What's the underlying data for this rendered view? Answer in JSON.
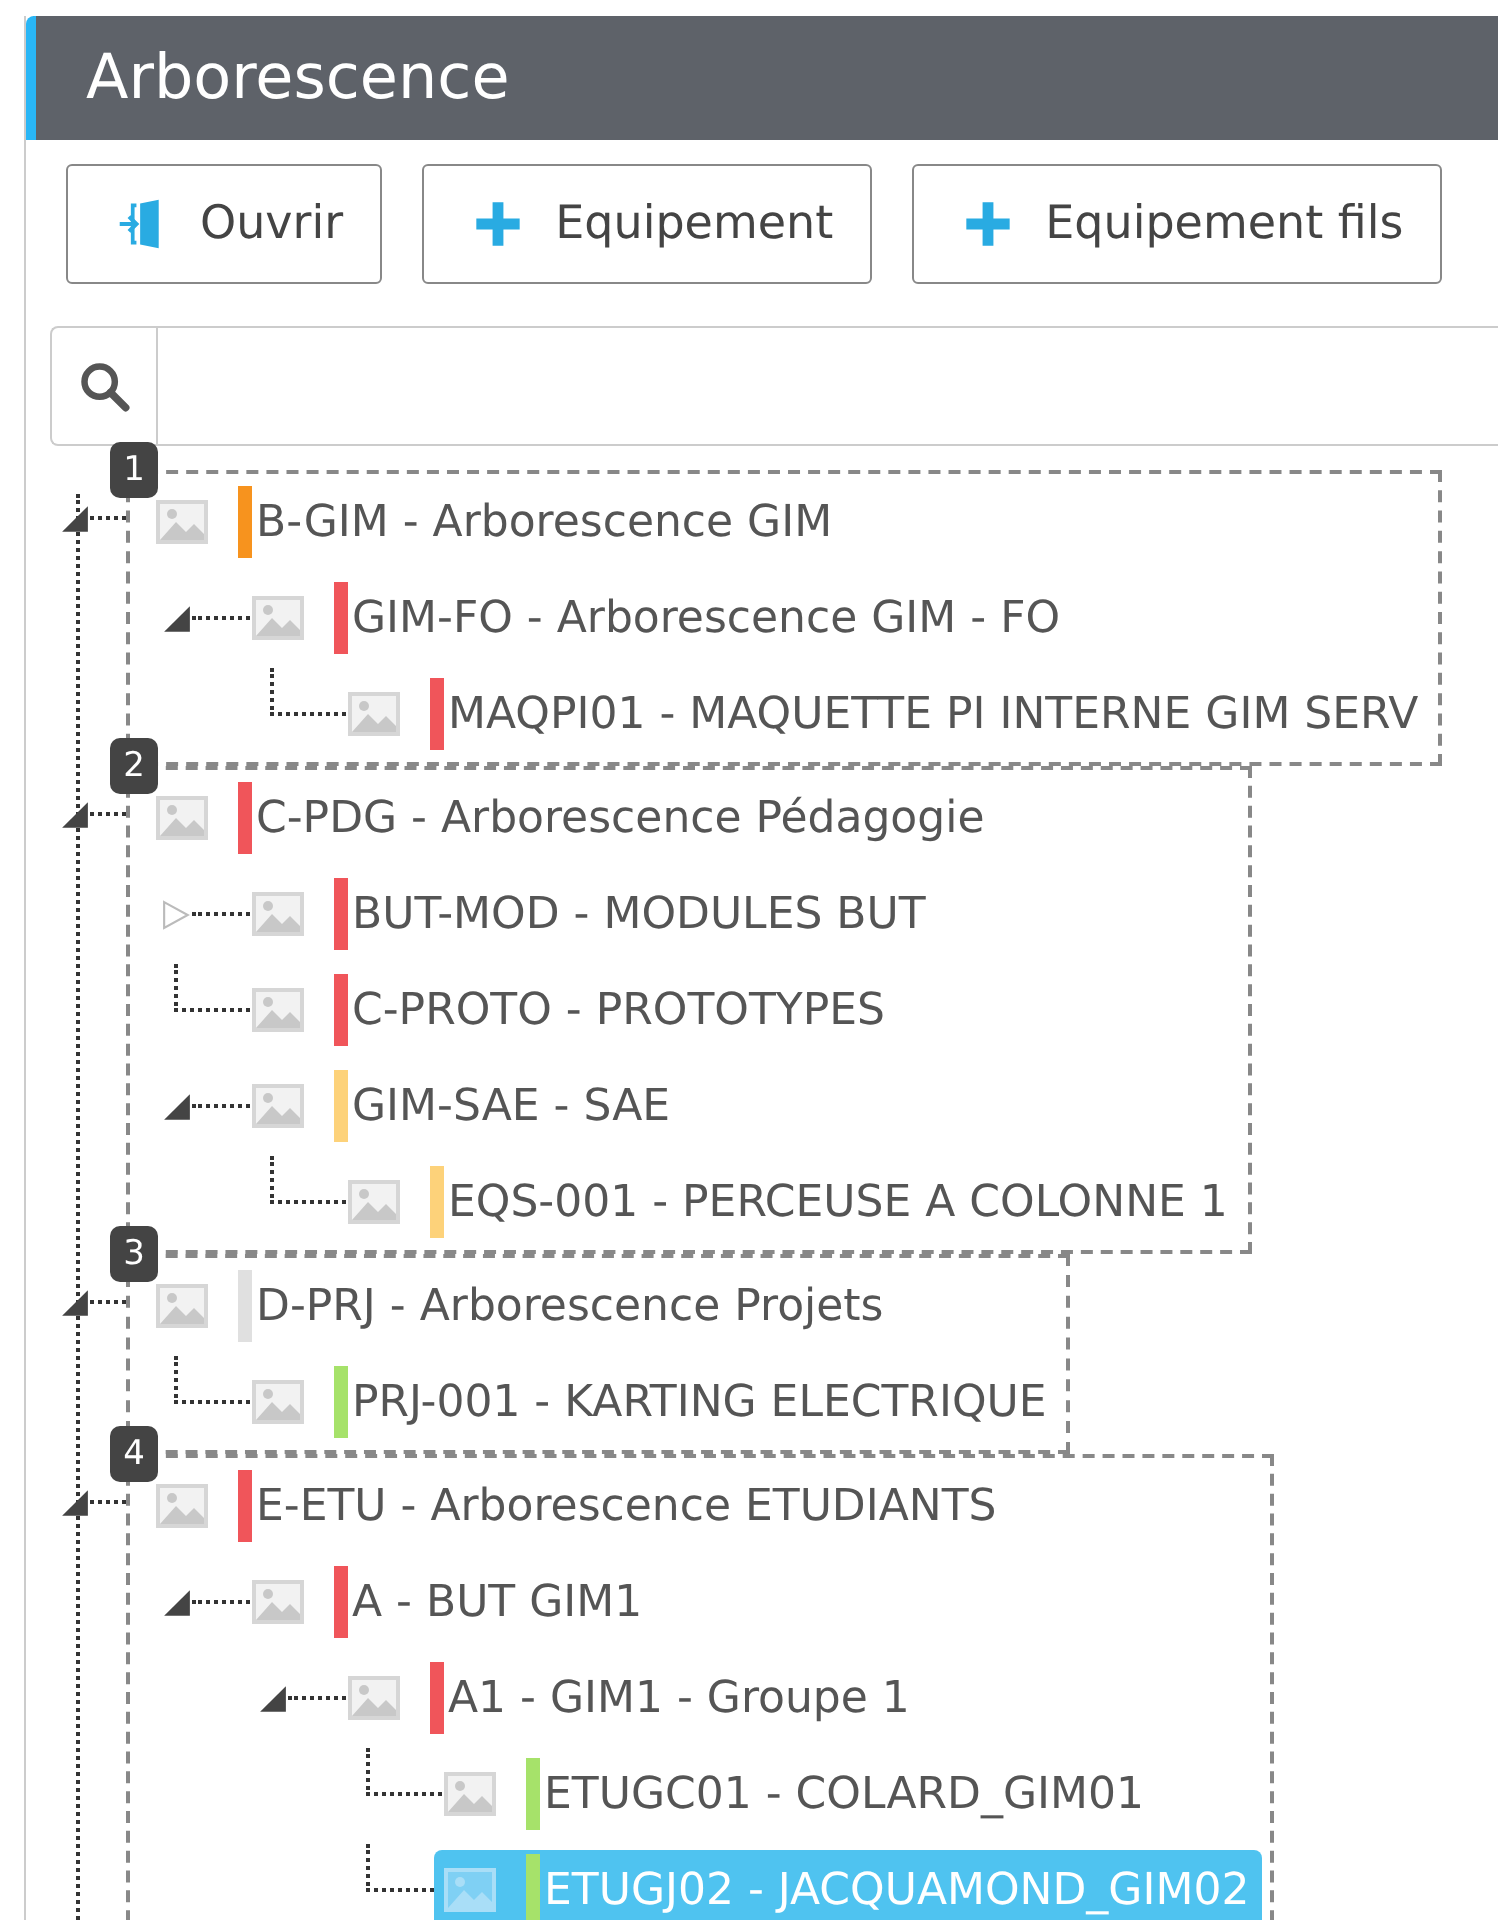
{
  "title": "Arborescence",
  "toolbar": [
    {
      "label": "Ouvrir",
      "kind": "open"
    },
    {
      "label": "Equipement",
      "kind": "add"
    },
    {
      "label": "Equipement fils",
      "kind": "add"
    }
  ],
  "tree": [
    {
      "badge": "1",
      "node": {
        "label": "B-GIM - Arborescence GIM",
        "color": "#f7931e",
        "expanded": true,
        "selected": false,
        "children": [
          {
            "label": "GIM-FO - Arborescence GIM - FO",
            "color": "#f0555a",
            "expanded": true,
            "selected": false,
            "children": [
              {
                "label": "MAQPI01 - MAQUETTE PI INTERNE GIM SERV",
                "color": "#f0555a",
                "selected": false
              }
            ]
          }
        ]
      }
    },
    {
      "badge": "2",
      "node": {
        "label": "C-PDG - Arborescence Pédagogie",
        "color": "#f0555a",
        "expanded": true,
        "selected": false,
        "children": [
          {
            "label": "BUT-MOD - MODULES BUT",
            "color": "#f0555a",
            "expanded": false,
            "selected": false
          },
          {
            "label": "C-PROTO - PROTOTYPES",
            "color": "#f0555a",
            "selected": false
          },
          {
            "label": "GIM-SAE - SAE",
            "color": "#fdd27a",
            "expanded": true,
            "selected": false,
            "children": [
              {
                "label": "EQS-001 - PERCEUSE A COLONNE 1",
                "color": "#fdd27a",
                "selected": false
              }
            ]
          }
        ]
      }
    },
    {
      "badge": "3",
      "node": {
        "label": "D-PRJ - Arborescence Projets",
        "color": "#e0e0e0",
        "expanded": true,
        "selected": false,
        "children": [
          {
            "label": "PRJ-001 - KARTING ELECTRIQUE",
            "color": "#a6e26a",
            "selected": false
          }
        ]
      }
    },
    {
      "badge": "4",
      "node": {
        "label": "E-ETU - Arborescence ETUDIANTS",
        "color": "#f0555a",
        "expanded": true,
        "selected": false,
        "children": [
          {
            "label": "A - BUT GIM1",
            "color": "#f0555a",
            "expanded": true,
            "selected": false,
            "children": [
              {
                "label": "A1 - GIM1 - Groupe 1",
                "color": "#f0555a",
                "expanded": true,
                "selected": false,
                "children": [
                  {
                    "label": "ETUGC01 - COLARD_GIM01",
                    "color": "#a6e26a",
                    "selected": false
                  },
                  {
                    "label": "ETUGJ02 - JACQUAMOND_GIM02",
                    "color": "#a6e26a",
                    "selected": true
                  }
                ]
              }
            ]
          }
        ]
      }
    }
  ]
}
